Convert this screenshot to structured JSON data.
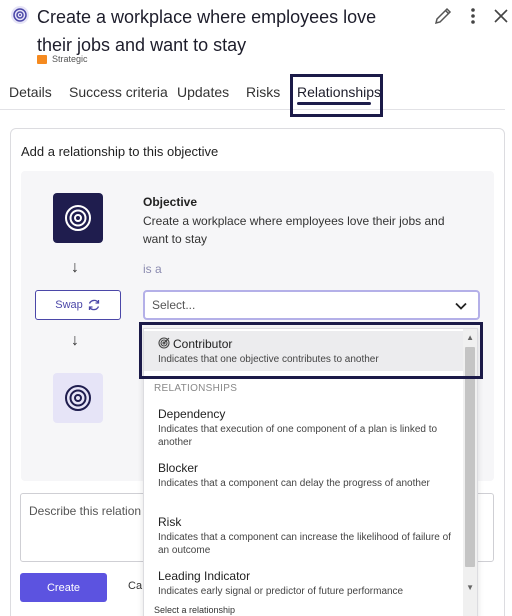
{
  "header": {
    "title": "Create a workplace where employees love their jobs and want to stay",
    "badge": "Strategic",
    "badge_color": "#f58a1f"
  },
  "tabs": [
    {
      "label": "Details"
    },
    {
      "label": "Success criteria"
    },
    {
      "label": "Updates"
    },
    {
      "label": "Risks"
    },
    {
      "label": "Relationships",
      "active": true
    }
  ],
  "form": {
    "heading": "Add a relationship to this objective",
    "objective_label": "Objective",
    "objective_text": "Create a workplace where employees love their jobs and want to stay",
    "is_a": "is a",
    "swap_label": "Swap",
    "select_placeholder": "Select...",
    "description_placeholder": "Describe this relation",
    "create_label": "Create",
    "cancel_label": "Ca"
  },
  "dropdown": {
    "options": [
      {
        "title": "Contributor",
        "desc": "Indicates that one objective contributes to another",
        "highlighted": true
      },
      {
        "title": "Dependency",
        "desc": "Indicates that execution of one component of a plan is linked to another"
      },
      {
        "title": "Blocker",
        "desc": "Indicates that a component can delay the progress of another"
      },
      {
        "title": "Risk",
        "desc": "Indicates that a component can increase the likelihood of failure of an outcome"
      },
      {
        "title": "Leading Indicator",
        "desc": "Indicates early signal or predictor of future performance"
      }
    ],
    "section_header": "RELATIONSHIPS",
    "footer_hint": "Select a relationship"
  },
  "colors": {
    "accent": "#5c53e0",
    "dark_icon_bg": "#1f1d4e"
  }
}
